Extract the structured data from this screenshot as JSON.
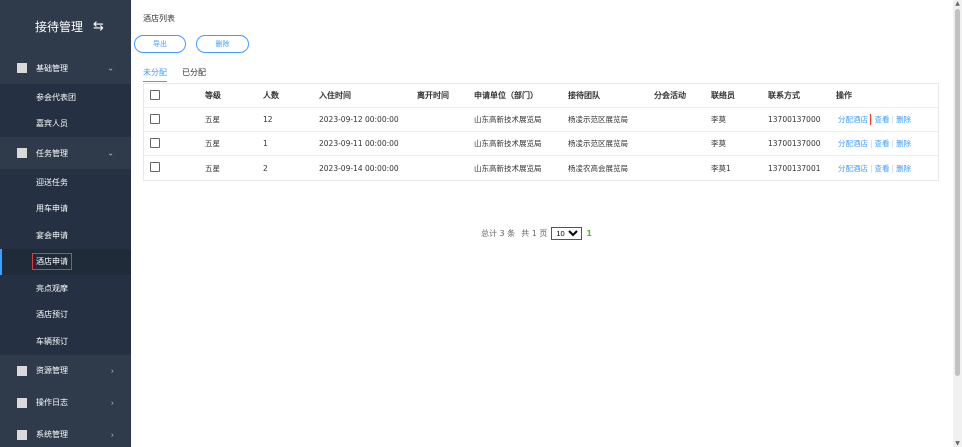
{
  "sidebar": {
    "title": "接待管理",
    "swap_icon": "⇆",
    "groups": [
      {
        "label": "基础管理",
        "arrow": "⌄"
      },
      {
        "label": "任务管理",
        "arrow": "⌄"
      },
      {
        "label": "资源管理",
        "arrow": "›"
      },
      {
        "label": "操作日志",
        "arrow": "›"
      },
      {
        "label": "系统管理",
        "arrow": "›"
      }
    ],
    "basic_items": [
      "参会代表团",
      "嘉宾人员"
    ],
    "task_items": [
      "迎送任务",
      "用车申请",
      "宴会申请",
      "酒店申请",
      "亮点观摩",
      "酒店预订",
      "车辆预订"
    ]
  },
  "main": {
    "page_title": "酒店列表",
    "export_label": "导出",
    "delete_label": "删除",
    "tabs": [
      "未分配",
      "已分配"
    ],
    "columns": [
      "等级",
      "人数",
      "入住时间",
      "离开时间",
      "申请单位（部门）",
      "接待团队",
      "分会活动",
      "联络员",
      "联系方式",
      "操作"
    ],
    "rows": [
      {
        "level": "五星",
        "count": "12",
        "checkin": "2023-09-12 00:00:00",
        "checkout": "",
        "unit": "山东高新技术展览局",
        "team": "杨凌示范区展览局",
        "activity": "",
        "contact": "李莫",
        "phone": "13700137000"
      },
      {
        "level": "五星",
        "count": "1",
        "checkin": "2023-09-11 00:00:00",
        "checkout": "",
        "unit": "山东高新技术展览局",
        "team": "杨凌示范区展览局",
        "activity": "",
        "contact": "李莫",
        "phone": "13700137000"
      },
      {
        "level": "五星",
        "count": "2",
        "checkin": "2023-09-14 00:00:00",
        "checkout": "",
        "unit": "山东高新技术展览局",
        "team": "杨凌农高会展览局",
        "activity": "",
        "contact": "李莫1",
        "phone": "13700137001"
      }
    ],
    "actions": [
      "分配酒店",
      "查看",
      "删除"
    ],
    "pager": {
      "total": "总计 3 条",
      "pages": "共 1 页",
      "page_size": "10",
      "current": "1"
    }
  }
}
